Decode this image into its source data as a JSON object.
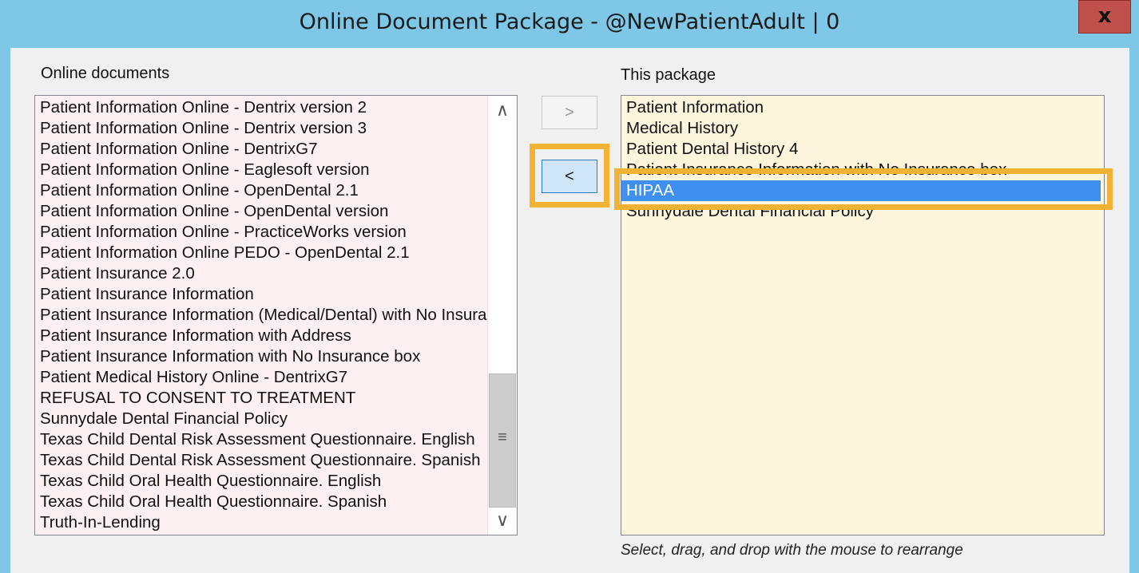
{
  "window": {
    "title": "Online Document Package - @NewPatientAdult | 0",
    "close_glyph": "x"
  },
  "online_documents": {
    "label": "Online documents",
    "items": [
      "Patient Information Online - Dentrix version 2",
      "Patient Information Online - Dentrix version 3",
      "Patient Information Online - DentrixG7",
      "Patient Information Online - Eaglesoft version",
      "Patient Information Online - OpenDental 2.1",
      "Patient Information Online - OpenDental version",
      "Patient Information Online - PracticeWorks version",
      "Patient Information Online PEDO - OpenDental 2.1",
      "Patient Insurance 2.0",
      "Patient Insurance Information",
      "Patient Insurance Information (Medical/Dental) with No Insurance box",
      "Patient Insurance Information with Address",
      "Patient Insurance Information with No Insurance box",
      "Patient Medical History Online - DentrixG7",
      "REFUSAL TO CONSENT TO TREATMENT",
      "Sunnydale Dental Financial Policy",
      "Texas Child Dental Risk Assessment Questionnaire. English",
      "Texas Child Dental Risk Assessment Questionnaire. Spanish",
      "Texas Child Oral Health Questionnaire. English",
      "Texas Child Oral Health Questionnaire. Spanish",
      "Truth-In-Lending"
    ],
    "scroll": {
      "up_glyph": "∧",
      "down_glyph": "∨",
      "grip_glyph": "≡"
    }
  },
  "buttons": {
    "add_label": ">",
    "remove_label": "<"
  },
  "this_package": {
    "label": "This package",
    "items": [
      "Patient Information",
      "Medical History",
      "Patient Dental History 4",
      "Patient Insurance Information with No Insurance box",
      "HIPAA",
      "Sunnydale Dental Financial Policy"
    ],
    "selected_index": 4,
    "hint": "Select, drag, and drop with the mouse to rearrange"
  },
  "colors": {
    "titlebar": "#7ec7e6",
    "close_button": "#c0504b",
    "highlight": "#f2b233",
    "selection": "#3f8ff0",
    "left_list_bg": "#fdf0f3",
    "right_list_bg": "#fdf6dc"
  }
}
